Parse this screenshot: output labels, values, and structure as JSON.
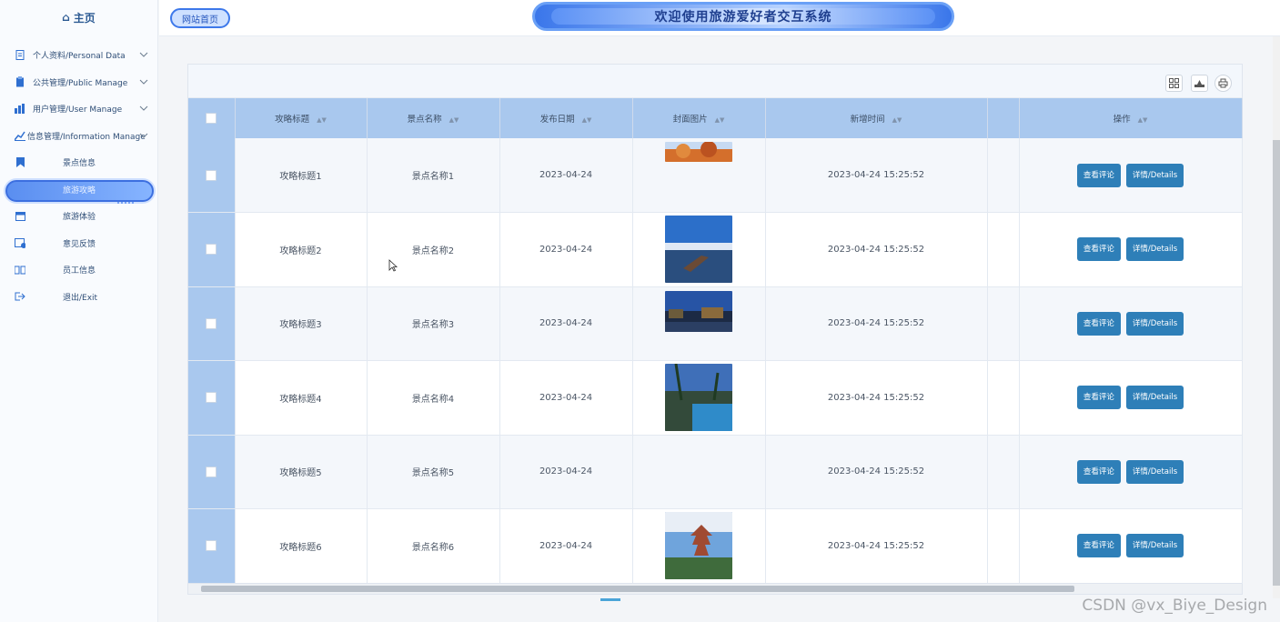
{
  "sidebar": {
    "home_label": "主页",
    "items": [
      {
        "label": "个人资料/Personal Data",
        "icon": "document-icon",
        "expandable": true
      },
      {
        "label": "公共管理/Public Manage",
        "icon": "clipboard-icon",
        "expandable": true
      },
      {
        "label": "用户管理/User Manage",
        "icon": "users-icon",
        "expandable": true
      },
      {
        "label": "信息管理/Information Manage",
        "icon": "chart-icon",
        "expandable": true
      },
      {
        "label": "景点信息",
        "icon": "bookmark-icon",
        "expandable": false
      },
      {
        "label": "旅游攻略",
        "icon": "",
        "expandable": false,
        "active": true
      },
      {
        "label": "旅游体验",
        "icon": "calendar-icon",
        "expandable": false
      },
      {
        "label": "意见反馈",
        "icon": "calendar-check-icon",
        "expandable": false
      },
      {
        "label": "员工信息",
        "icon": "book-icon",
        "expandable": false
      },
      {
        "label": "退出/Exit",
        "icon": "logout-icon",
        "expandable": false
      }
    ]
  },
  "topbar": {
    "site_link": "网站首页",
    "banner_title": "欢迎使用旅游爱好者交互系统"
  },
  "table": {
    "headers": [
      "攻略标题",
      "景点名称",
      "发布日期",
      "封面图片",
      "新增时间",
      "操作"
    ],
    "rows": [
      {
        "title": "攻略标题1",
        "spot": "景点名称1",
        "date": "2023-04-24",
        "created": "2023-04-24 15:25:52",
        "cover": "autumn-trees"
      },
      {
        "title": "攻略标题2",
        "spot": "景点名称2",
        "date": "2023-04-24",
        "created": "2023-04-24 15:25:52",
        "cover": "lake-boat"
      },
      {
        "title": "攻略标题3",
        "spot": "景点名称3",
        "date": "2023-04-24",
        "created": "2023-04-24 15:25:52",
        "cover": "night-town"
      },
      {
        "title": "攻略标题4",
        "spot": "景点名称4",
        "date": "2023-04-24",
        "created": "2023-04-24 15:25:52",
        "cover": "resort-pool"
      },
      {
        "title": "攻略标题5",
        "spot": "景点名称5",
        "date": "2023-04-24",
        "created": "2023-04-24 15:25:52",
        "cover": ""
      },
      {
        "title": "攻略标题6",
        "spot": "景点名称6",
        "date": "2023-04-24",
        "created": "2023-04-24 15:25:52",
        "cover": "pagoda"
      }
    ],
    "action_view_comments": "查看评论",
    "action_details": "详情/Details"
  },
  "watermark": "CSDN @vx_Biye_Design",
  "colors": {
    "accent": "#2e7fb8",
    "header_bg": "#a9c8ee",
    "banner": "#3a76ea"
  }
}
